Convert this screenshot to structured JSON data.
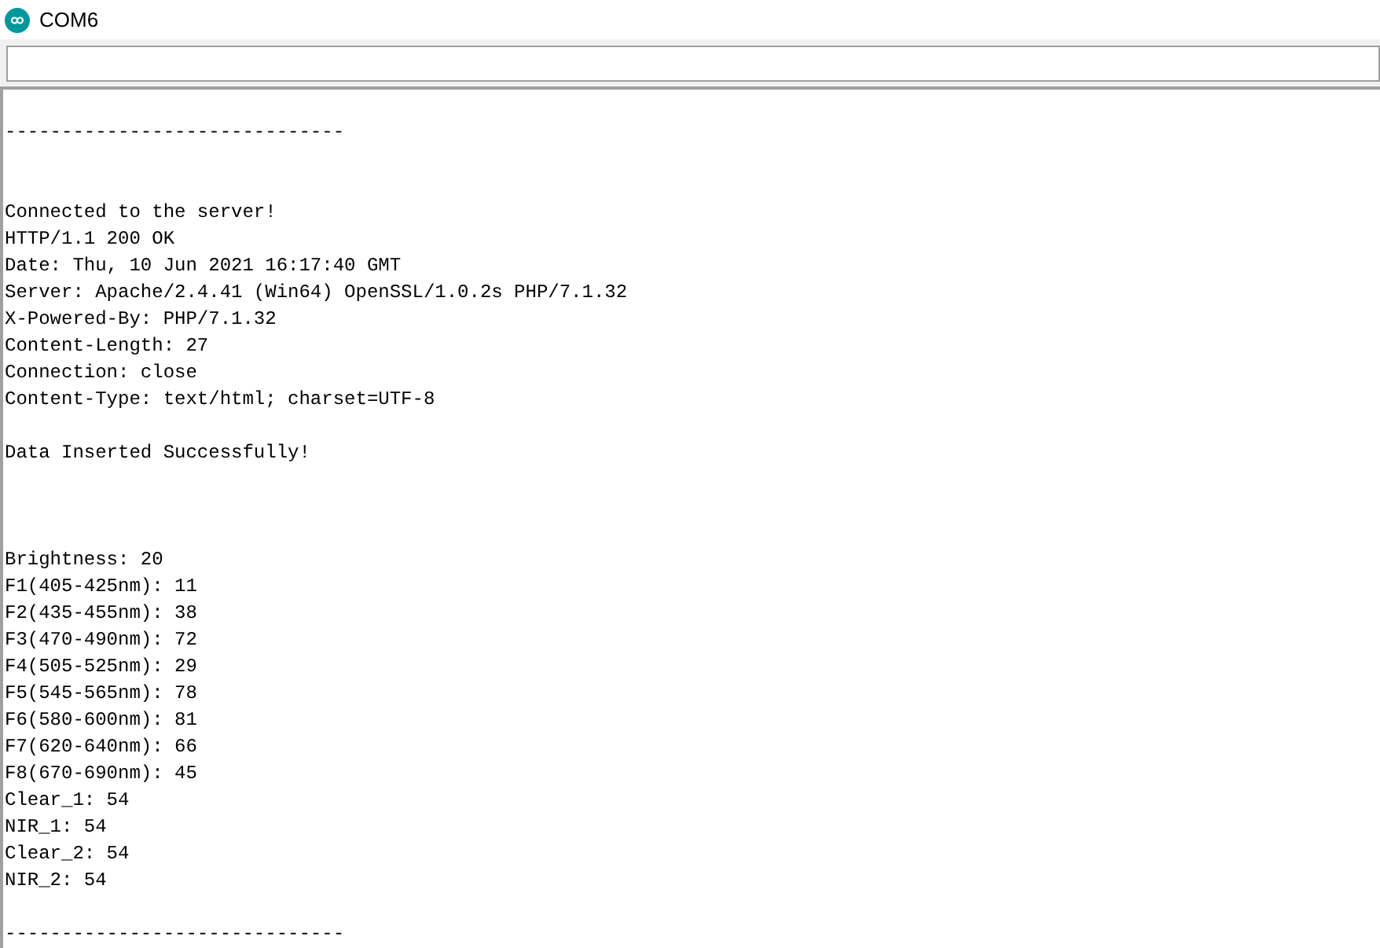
{
  "window": {
    "title": "COM6"
  },
  "output": [
    {
      "kind": "rule",
      "lines": [
        "------------------------------"
      ]
    },
    {
      "kind": "connection",
      "lines": [
        "Connected to the server!",
        "HTTP/1.1 200 OK",
        "Date: Thu, 10 Jun 2021 16:17:40 GMT",
        "Server: Apache/2.4.41 (Win64) OpenSSL/1.0.2s PHP/7.1.32",
        "X-Powered-By: PHP/7.1.32",
        "Content-Length: 27",
        "Connection: close",
        "Content-Type: text/html; charset=UTF-8"
      ]
    },
    {
      "kind": "response_body",
      "lines": [
        "Data Inserted Successfully!"
      ]
    },
    {
      "kind": "readings",
      "lines": [
        "Brightness: 20",
        "F1(405-425nm): 11",
        "F2(435-455nm): 38",
        "F3(470-490nm): 72",
        "F4(505-525nm): 29",
        "F5(545-565nm): 78",
        "F6(580-600nm): 81",
        "F7(620-640nm): 66",
        "F8(670-690nm): 45",
        "Clear_1: 54",
        "NIR_1: 54",
        "Clear_2: 54",
        "NIR_2: 54"
      ]
    },
    {
      "kind": "rule",
      "lines": [
        "------------------------------"
      ]
    }
  ]
}
